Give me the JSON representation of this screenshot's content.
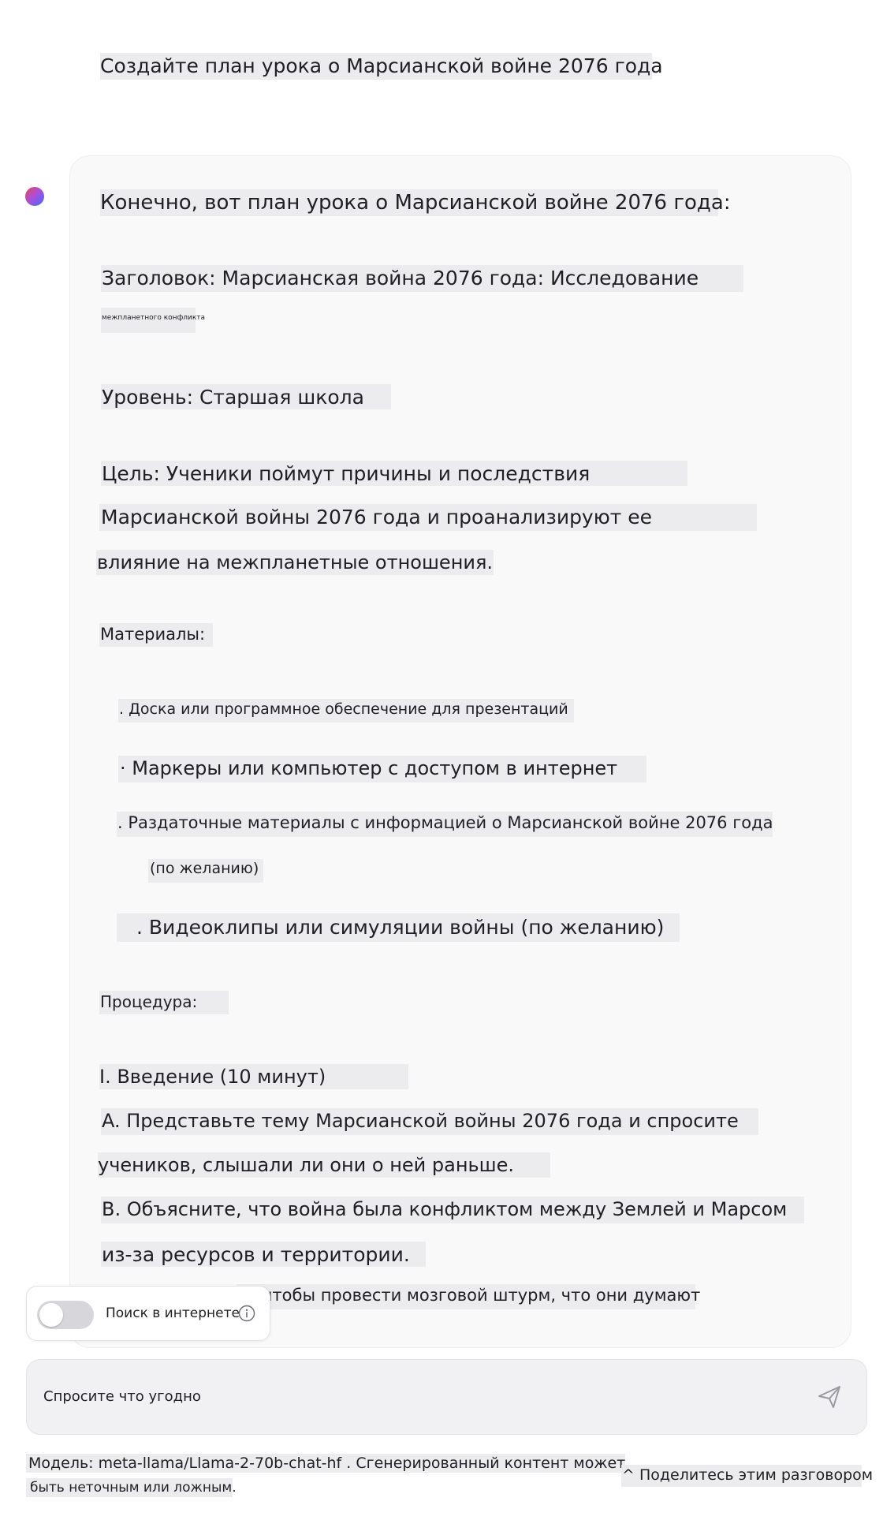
{
  "user_message": "Создайте план урока о Марсианской войне 2076 года",
  "assistant": {
    "intro": "Конечно, вот план урока о Марсианской войне 2076 года:",
    "title_line1": "Заголовок: Марсианская война 2076 года: Исследование",
    "title_line2": "межпланетного конфликта",
    "level": "Уровень: Старшая школа",
    "goal_line1": "Цель: Ученики поймут причины и последствия",
    "goal_line2": "Марсианской войны 2076 года и проанализируют ее",
    "goal_line3": "влияние на межпланетные отношения.",
    "materials_heading": "Материалы:",
    "materials": [
      ". Доска или программное обеспечение для презентаций",
      "· Маркеры или компьютер с доступом в интернет",
      ". Раздаточные материалы с информацией о Марсианской войне 2076 года",
      "(по желанию)",
      ". Видеоклипы или симуляции войны (по желанию)"
    ],
    "procedure_heading": "Процедура:",
    "section1": "I. Введение (10 минут)",
    "a_line1": "A. Представьте тему Марсианской войны 2076 года и спросите",
    "a_line2": "учеников, слышали ли они о ней раньше.",
    "b_line1": "B. Объясните, что война была конфликтом между Землей и Марсом",
    "b_line2": "из-за ресурсов и территории.",
    "c_partial": "чтобы провести мозговой штурм, что они думают"
  },
  "web_search": {
    "label": "Поиск в интернете",
    "enabled": false
  },
  "composer": {
    "placeholder": "Спросите что угодно"
  },
  "footer": {
    "disclaimer_line1": "Модель: meta-llama/Llama-2-70b-chat-hf . Сгенерированный контент может",
    "disclaimer_line2": "быть неточным или ложным.",
    "share": "^ Поделитесь этим разговором"
  },
  "icons": {
    "avatar": "assistant-avatar-icon",
    "info": "info-icon",
    "send": "send-icon"
  },
  "colors": {
    "highlight": "#ececee",
    "bubble": "#f9f9fa",
    "composer": "#f1f1f3"
  }
}
